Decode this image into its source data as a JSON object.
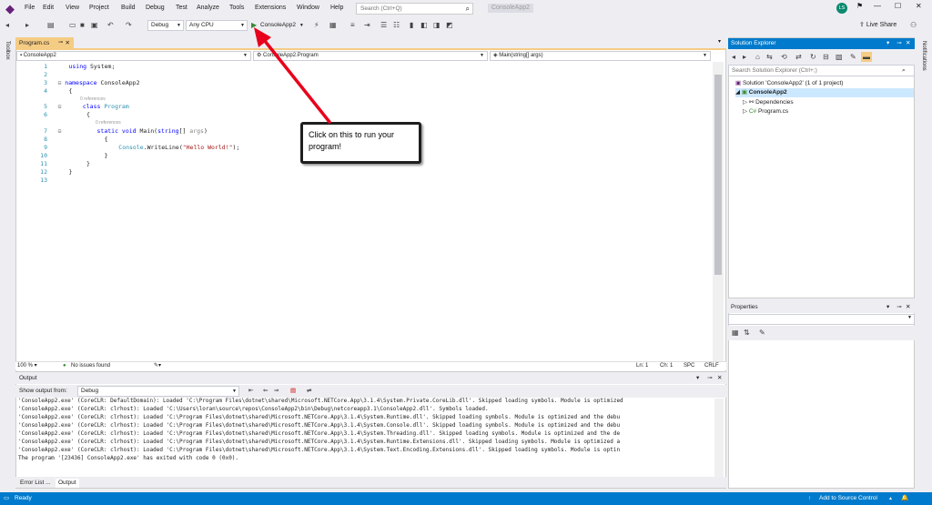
{
  "menu": {
    "items": [
      "File",
      "Edit",
      "View",
      "Project",
      "Build",
      "Debug",
      "Test",
      "Analyze",
      "Tools",
      "Extensions",
      "Window",
      "Help"
    ],
    "search_placeholder": "Search (Ctrl+Q)",
    "app_title": "ConsoleApp2",
    "user_initials": "LS"
  },
  "toolbar": {
    "config": "Debug",
    "platform": "Any CPU",
    "run_label": "ConsoleApp2",
    "live_share": "Live Share"
  },
  "left_strip": {
    "label": "Toolbox"
  },
  "right_strip": {
    "label": "Notifications"
  },
  "editor": {
    "tab_label": "Program.cs",
    "nav_project": "ConsoleApp2",
    "nav_class": "ConsoleApp2.Program",
    "nav_member": "Main(string[] args)",
    "references": "0 references",
    "lines": [
      {
        "n": "1",
        "text": "using System;"
      },
      {
        "n": "2",
        "text": ""
      },
      {
        "n": "3",
        "text": "namespace ConsoleApp2"
      },
      {
        "n": "4",
        "text": "{"
      },
      {
        "n": "5",
        "text": "class Program"
      },
      {
        "n": "6",
        "text": "{"
      },
      {
        "n": "7",
        "text": "static void Main(string[] args)"
      },
      {
        "n": "8",
        "text": "{"
      },
      {
        "n": "9",
        "text": "Console.WriteLine(\"Hello World!\");"
      },
      {
        "n": "10",
        "text": "}"
      },
      {
        "n": "11",
        "text": "}"
      },
      {
        "n": "12",
        "text": "}"
      },
      {
        "n": "13",
        "text": ""
      }
    ],
    "zoom": "100 %",
    "issues": "No issues found",
    "ln": "Ln: 1",
    "ch": "Ch: 1",
    "spc": "SPC",
    "crlf": "CRLF"
  },
  "output": {
    "title": "Output",
    "show_from_label": "Show output from:",
    "show_from_value": "Debug",
    "lines": [
      "'ConsoleApp2.exe' (CoreCLR: DefaultDomain): Loaded 'C:\\Program Files\\dotnet\\shared\\Microsoft.NETCore.App\\3.1.4\\System.Private.CoreLib.dll'. Skipped loading symbols. Module is optimized",
      "'ConsoleApp2.exe' (CoreCLR: clrhost): Loaded 'C:\\Users\\loran\\source\\repos\\ConsoleApp2\\bin\\Debug\\netcoreapp3.1\\ConsoleApp2.dll'. Symbols loaded.",
      "'ConsoleApp2.exe' (CoreCLR: clrhost): Loaded 'C:\\Program Files\\dotnet\\shared\\Microsoft.NETCore.App\\3.1.4\\System.Runtime.dll'. Skipped loading symbols. Module is optimized and the debu",
      "'ConsoleApp2.exe' (CoreCLR: clrhost): Loaded 'C:\\Program Files\\dotnet\\shared\\Microsoft.NETCore.App\\3.1.4\\System.Console.dll'. Skipped loading symbols. Module is optimized and the debu",
      "'ConsoleApp2.exe' (CoreCLR: clrhost): Loaded 'C:\\Program Files\\dotnet\\shared\\Microsoft.NETCore.App\\3.1.4\\System.Threading.dll'. Skipped loading symbols. Module is optimized and the de",
      "'ConsoleApp2.exe' (CoreCLR: clrhost): Loaded 'C:\\Program Files\\dotnet\\shared\\Microsoft.NETCore.App\\3.1.4\\System.Runtime.Extensions.dll'. Skipped loading symbols. Module is optimized a",
      "'ConsoleApp2.exe' (CoreCLR: clrhost): Loaded 'C:\\Program Files\\dotnet\\shared\\Microsoft.NETCore.App\\3.1.4\\System.Text.Encoding.Extensions.dll'. Skipped loading symbols. Module is optin",
      "The program '[23436] ConsoleApp2.exe' has exited with code 0 (0x0)."
    ],
    "tabs": [
      "Error List ...",
      "Output"
    ]
  },
  "solution_explorer": {
    "title": "Solution Explorer",
    "search_placeholder": "Search Solution Explorer (Ctrl+;)",
    "solution": "Solution 'ConsoleApp2' (1 of 1 project)",
    "project": "ConsoleApp2",
    "dependencies": "Dependencies",
    "file": "Program.cs"
  },
  "properties": {
    "title": "Properties"
  },
  "status": {
    "ready": "Ready",
    "source_control": "Add to Source Control"
  },
  "callout": {
    "text": "Click on this to run your program!"
  },
  "colors": {
    "accent": "#007acc",
    "tab_active": "#f5cc84",
    "arrow": "#e8001c"
  }
}
